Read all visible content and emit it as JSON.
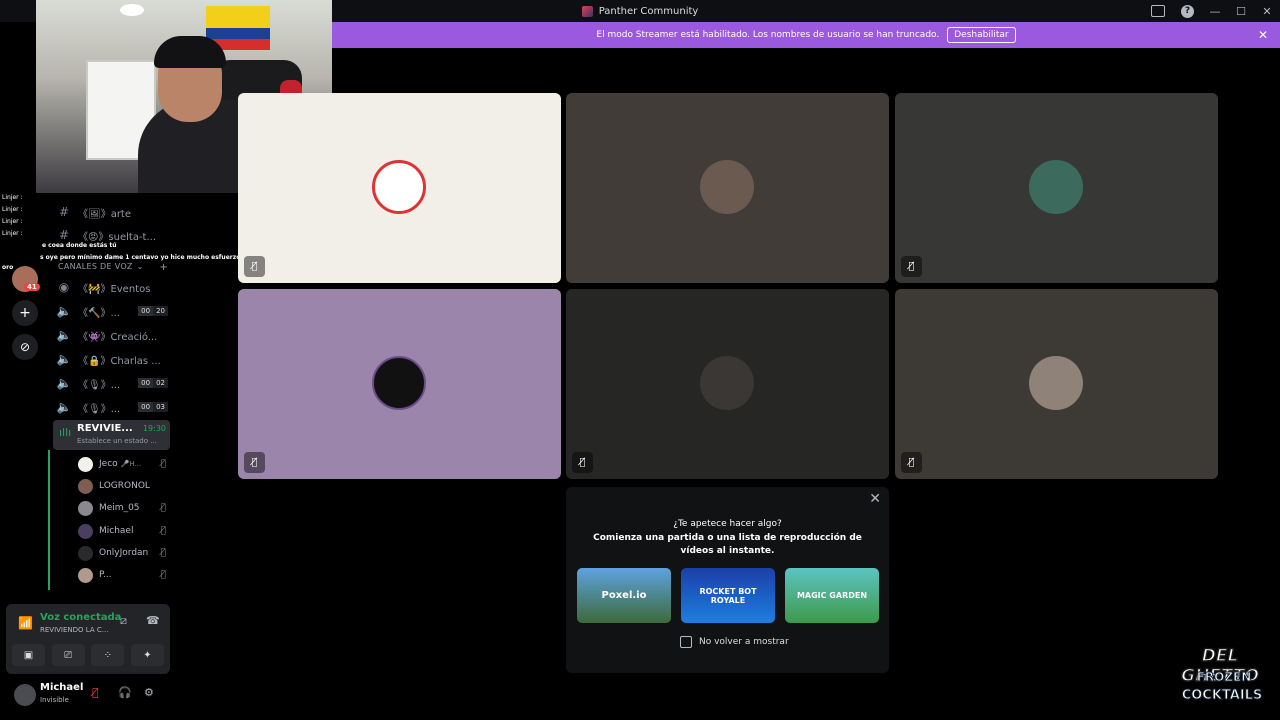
{
  "window": {
    "title": "Panther Community"
  },
  "banner": {
    "message": "El modo Streamer está habilitado. Los nombres de usuario se han truncado.",
    "button": "Deshabilitar"
  },
  "chat_overlay": {
    "lines": [
      "Linjer :",
      "Linjer :",
      "Linjer :",
      "Linjer :",
      "e coea donde estás tú",
      "s oye pero mínimo dame 1 centavo yo hice mucho esfuerzo mi tiempo vale",
      "oro"
    ]
  },
  "servers": {
    "badge": "41"
  },
  "channels": {
    "text": [
      {
        "symbol": "#",
        "label": "《🖼》arte"
      },
      {
        "symbol": "#",
        "label": "《😡》suelta-t..."
      }
    ],
    "category": "CANALES DE VOZ",
    "voice": [
      {
        "label": "《🚧》Eventos"
      },
      {
        "label": "《🔨》...",
        "count_a": "00",
        "count_b": "20"
      },
      {
        "label": "《👾》Creació..."
      },
      {
        "label": "《🔒》Charlas ..."
      },
      {
        "label": "《🎙》...",
        "count_a": "00",
        "count_b": "02"
      },
      {
        "label": "《🎙》...",
        "count_a": "00",
        "count_b": "03"
      }
    ],
    "active": {
      "name": "REVIVIE...",
      "time": "19:30",
      "status": "Establece un estado ..."
    },
    "members": [
      {
        "name": "Jeco",
        "extra": "🎤H..."
      },
      {
        "name": "LOGRONOL"
      },
      {
        "name": "Meim_05"
      },
      {
        "name": "Michael"
      },
      {
        "name": "OnlyJordan"
      },
      {
        "name": "P..."
      }
    ]
  },
  "voice_panel": {
    "status": "Voz conectada",
    "channel": "REVIVIENDO LA C..."
  },
  "user": {
    "name": "Michael",
    "status": "Invisible"
  },
  "activity": {
    "question": "¿Te apetece hacer algo?",
    "description": "Comienza una partida o una lista de reproducción de vídeos al instante.",
    "games": [
      "Poxel.io",
      "ROCKET BOT ROYALE",
      "MAGIC GARDEN"
    ],
    "checkbox": "No volver a mostrar"
  },
  "sponsor": {
    "line1": "DEL GHETTO",
    "line2": "FROZEN",
    "line3": "COCKTAILS"
  },
  "colors": {
    "banner": "#9b59e0",
    "online_green": "#23a55a",
    "tile_cream": "#f2efe9",
    "tile_purple": "#9b85aa"
  }
}
